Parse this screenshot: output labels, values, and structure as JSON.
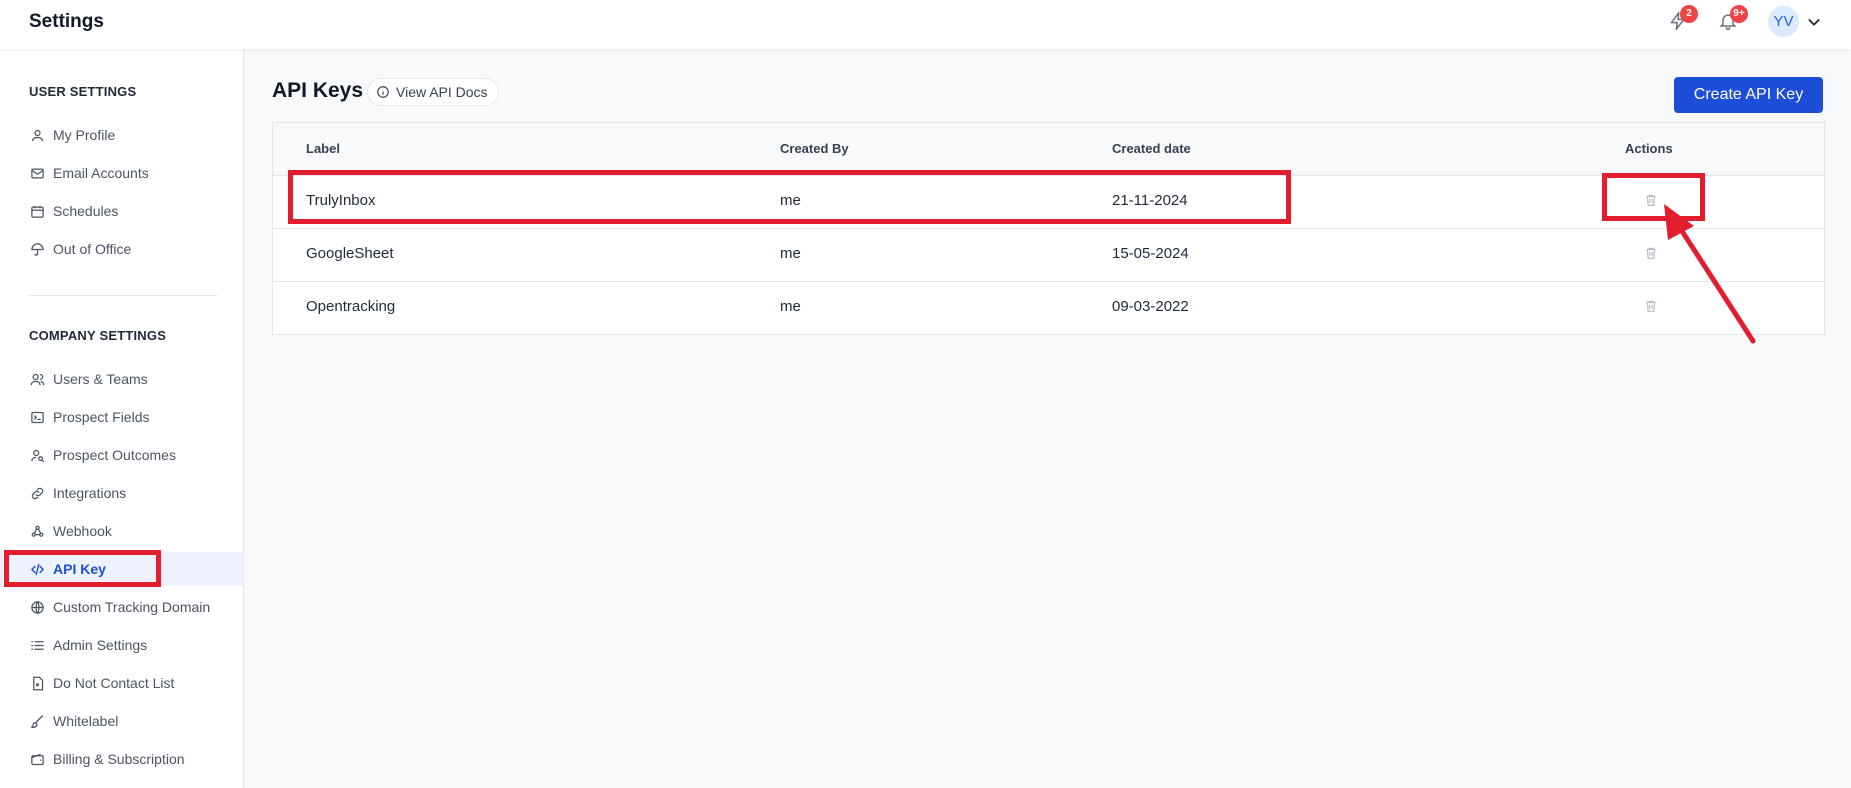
{
  "header": {
    "title": "Settings",
    "activity_badge": "2",
    "notifications_badge": "9+",
    "avatar_initials": "YV"
  },
  "sidebar": {
    "user_settings_title": "USER SETTINGS",
    "user_items": [
      {
        "label": "My Profile",
        "icon": "user-icon"
      },
      {
        "label": "Email Accounts",
        "icon": "mail-icon"
      },
      {
        "label": "Schedules",
        "icon": "calendar-icon"
      },
      {
        "label": "Out of Office",
        "icon": "umbrella-icon"
      }
    ],
    "company_settings_title": "COMPANY SETTINGS",
    "company_items": [
      {
        "label": "Users & Teams",
        "icon": "users-icon"
      },
      {
        "label": "Prospect Fields",
        "icon": "terminal-icon"
      },
      {
        "label": "Prospect Outcomes",
        "icon": "user-search-icon"
      },
      {
        "label": "Integrations",
        "icon": "link-icon"
      },
      {
        "label": "Webhook",
        "icon": "webhook-icon"
      },
      {
        "label": "API Key",
        "icon": "code-icon",
        "active": true
      },
      {
        "label": "Custom Tracking Domain",
        "icon": "globe-icon"
      },
      {
        "label": "Admin Settings",
        "icon": "list-icon"
      },
      {
        "label": "Do Not Contact List",
        "icon": "file-x-icon"
      },
      {
        "label": "Whitelabel",
        "icon": "brush-icon"
      },
      {
        "label": "Billing & Subscription",
        "icon": "wallet-icon"
      }
    ]
  },
  "main": {
    "title": "API Keys",
    "docs_link": "View API Docs",
    "create_button": "Create API Key",
    "columns": {
      "label": "Label",
      "created_by": "Created By",
      "created_date": "Created date",
      "actions": "Actions"
    },
    "rows": [
      {
        "label": "TrulyInbox",
        "created_by": "me",
        "created_date": "21-11-2024"
      },
      {
        "label": "GoogleSheet",
        "created_by": "me",
        "created_date": "15-05-2024"
      },
      {
        "label": "Opentracking",
        "created_by": "me",
        "created_date": "09-03-2022"
      }
    ]
  },
  "annotation_color": "#e11d2e",
  "accent_color": "#1d4ed8"
}
